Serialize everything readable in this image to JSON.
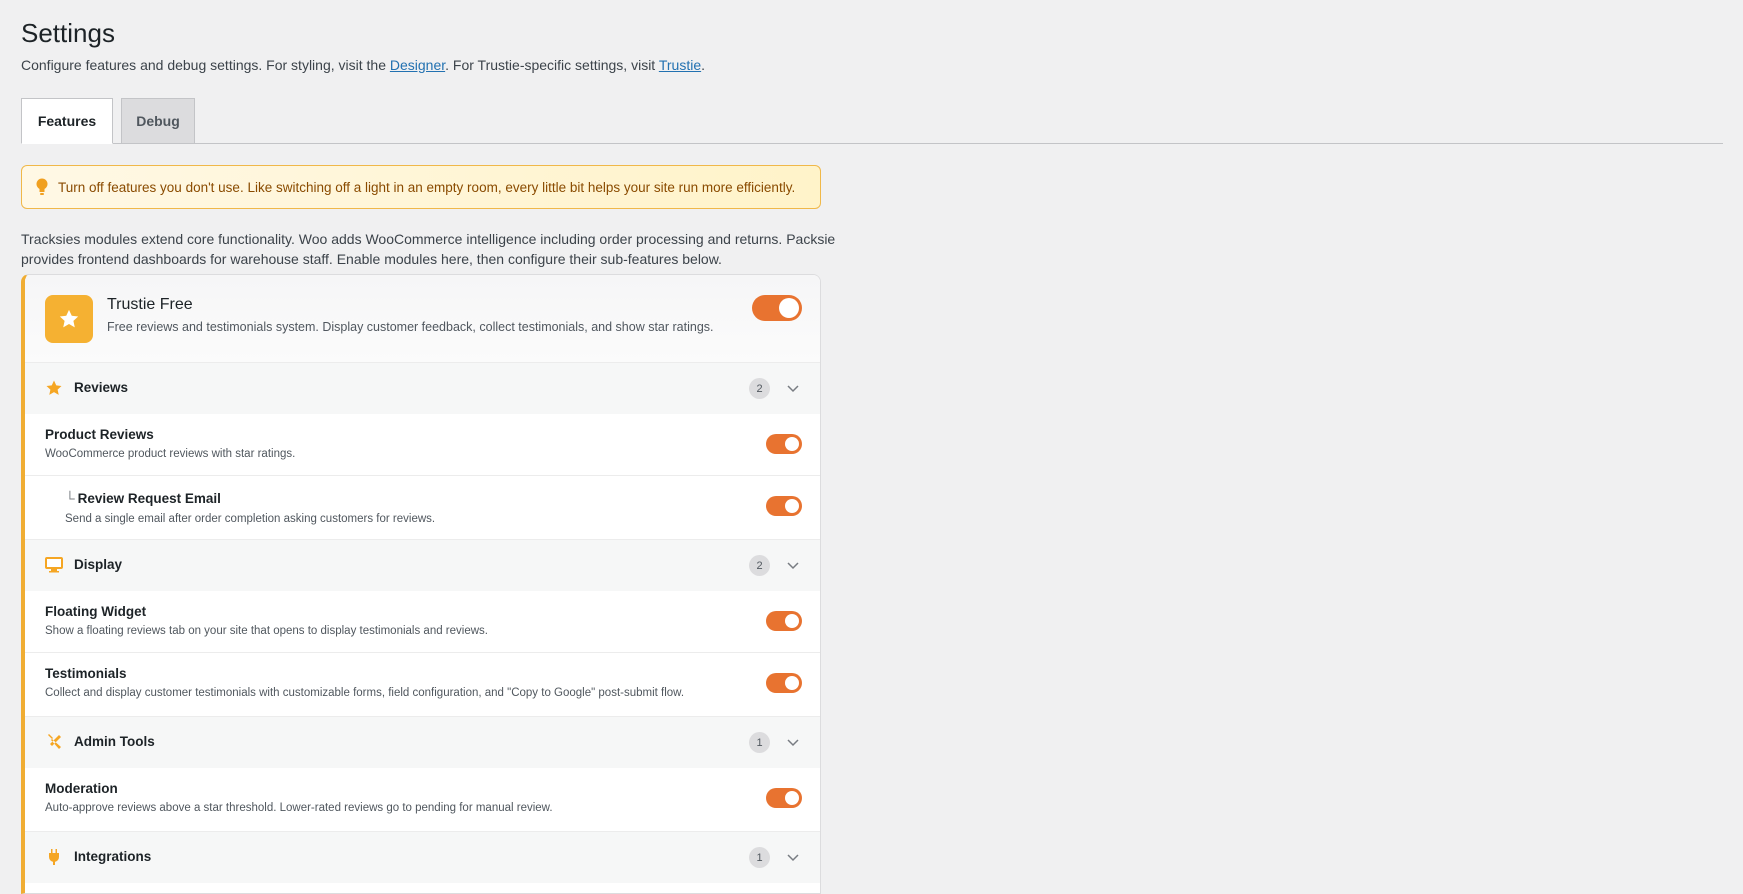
{
  "header": {
    "title": "Settings",
    "subtitle_pre": "Configure features and debug settings. For styling, visit the ",
    "designer_link": "Designer",
    "subtitle_mid": ". For Trustie-specific settings, visit ",
    "trustie_link": "Trustie",
    "subtitle_post": "."
  },
  "tabs": [
    {
      "label": "Features",
      "active": true
    },
    {
      "label": "Debug",
      "active": false
    }
  ],
  "notice": "Turn off features you don't use. Like switching off a light in an empty room, every little bit helps your site run more efficiently.",
  "intro": "Tracksies modules extend core functionality. Woo adds WooCommerce intelligence including order processing and returns. Packsie provides frontend dashboards for warehouse staff. Enable modules here, then configure their sub-features below.",
  "module": {
    "name": "Trustie Free",
    "description": "Free reviews and testimonials system. Display customer feedback, collect testimonials, and show star ratings.",
    "enabled": true
  },
  "sections": [
    {
      "label": "Reviews",
      "count": "2",
      "icon": "star-icon",
      "items": [
        {
          "name": "Product Reviews",
          "description": "WooCommerce product reviews with star ratings.",
          "enabled": true
        },
        {
          "name": "Review Request Email",
          "prefix": "└",
          "description": "Send a single email after order completion asking customers for reviews.",
          "enabled": true
        }
      ]
    },
    {
      "label": "Display",
      "count": "2",
      "icon": "monitor-icon",
      "items": [
        {
          "name": "Floating Widget",
          "description": "Show a floating reviews tab on your site that opens to display testimonials and reviews.",
          "enabled": true
        },
        {
          "name": "Testimonials",
          "description": "Collect and display customer testimonials with customizable forms, field configuration, and \"Copy to Google\" post-submit flow.",
          "enabled": true
        }
      ]
    },
    {
      "label": "Admin Tools",
      "count": "1",
      "icon": "tools-icon",
      "items": [
        {
          "name": "Moderation",
          "description": "Auto-approve reviews above a star threshold. Lower-rated reviews go to pending for manual review.",
          "enabled": true
        }
      ]
    },
    {
      "label": "Integrations",
      "count": "1",
      "icon": "plug-icon",
      "items": []
    }
  ],
  "colors": {
    "accent": "#e87330",
    "module": "#f5b132",
    "link": "#2271b1"
  }
}
